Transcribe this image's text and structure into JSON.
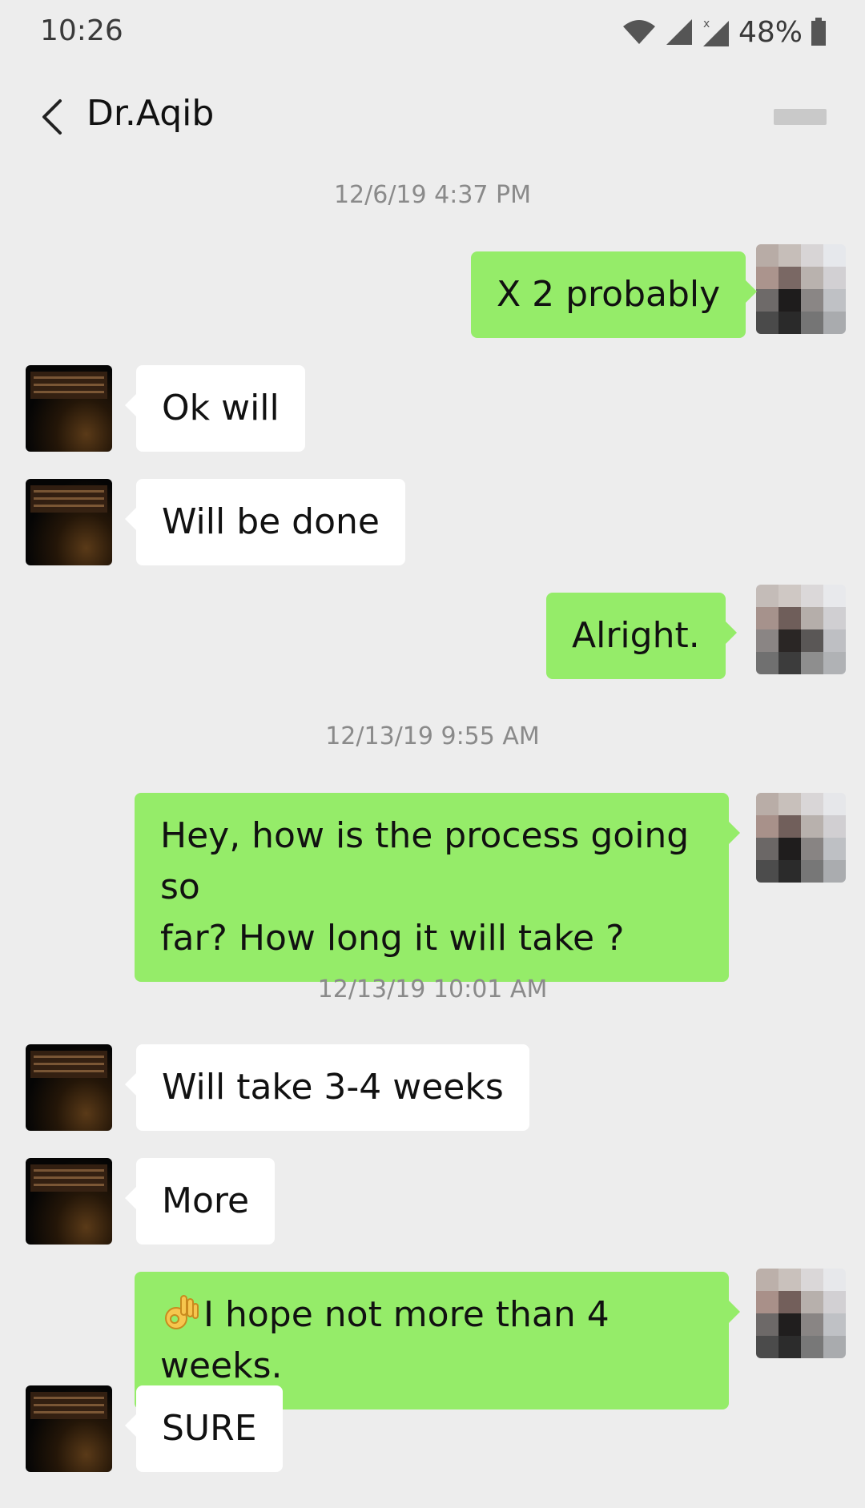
{
  "status": {
    "time": "10:26",
    "battery": "48%"
  },
  "header": {
    "title": "Dr.Aqib"
  },
  "messages": [
    {
      "type": "timestamp",
      "text": "12/6/19 4:37 PM"
    },
    {
      "type": "sent",
      "text": "X 2 probably"
    },
    {
      "type": "received",
      "text": "Ok will"
    },
    {
      "type": "received",
      "text": "Will be done"
    },
    {
      "type": "sent",
      "text": "Alright."
    },
    {
      "type": "timestamp",
      "text": "12/13/19 9:55 AM"
    },
    {
      "type": "sent",
      "line1": "Hey, how is the process going so",
      "line2": "far? How long it will take ?"
    },
    {
      "type": "timestamp",
      "text": "12/13/19 10:01 AM"
    },
    {
      "type": "received",
      "text": "Will take 3-4 weeks"
    },
    {
      "type": "received",
      "text": "More"
    },
    {
      "type": "sent",
      "emoji": "ok-hand-icon",
      "text": "I hope not more than 4 weeks."
    },
    {
      "type": "received",
      "text": "SURE"
    }
  ],
  "colors": {
    "background": "#ededed",
    "sent_bubble": "#95ec69",
    "received_bubble": "#ffffff"
  }
}
